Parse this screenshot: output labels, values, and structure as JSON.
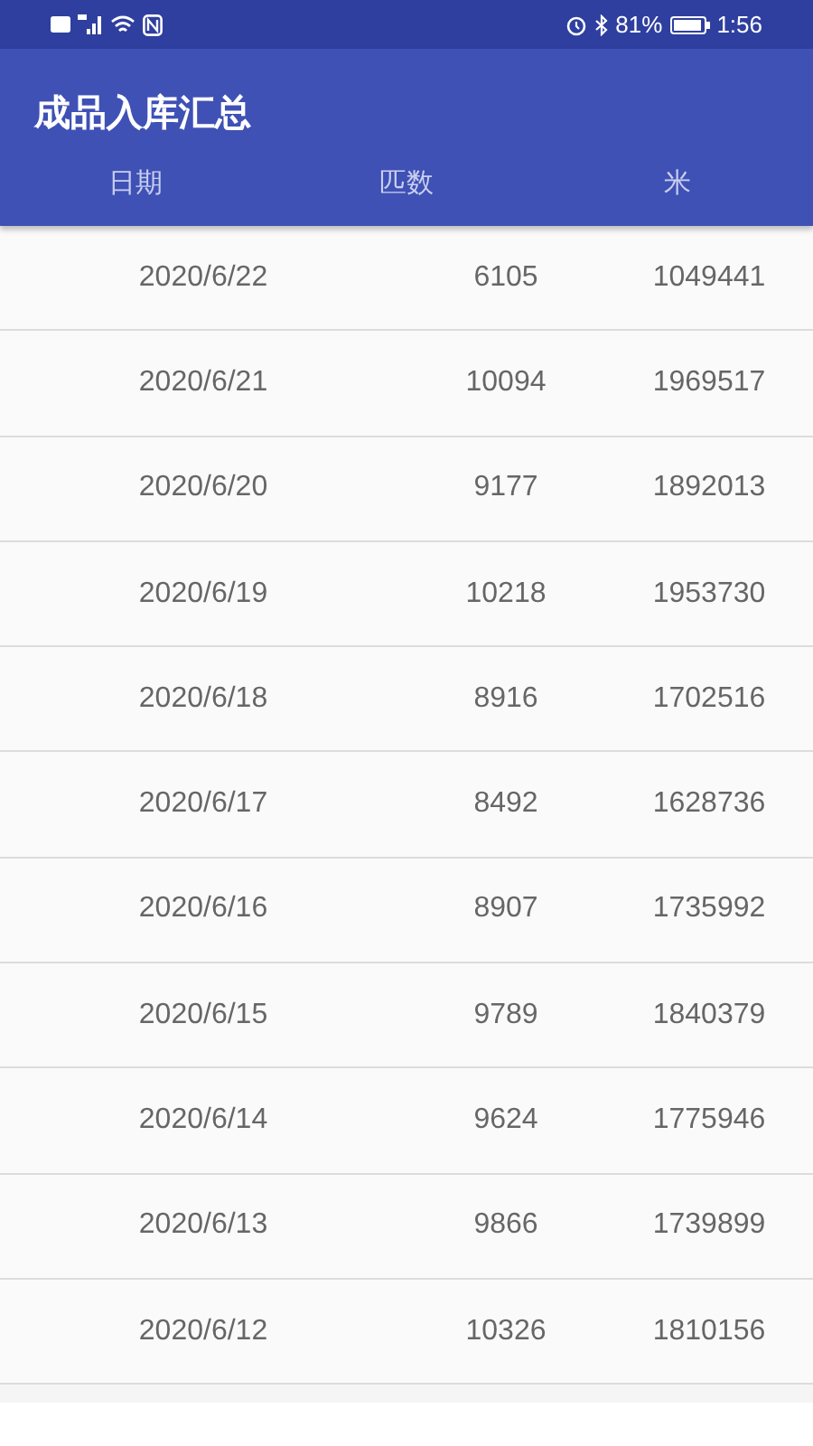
{
  "status_bar": {
    "battery_text": "81%",
    "time": "1:56"
  },
  "app_bar": {
    "title": "成品入库汇总"
  },
  "table": {
    "columns": [
      "日期",
      "匹数",
      "米"
    ],
    "rows": [
      [
        "2020/6/22",
        "6105",
        "1049441"
      ],
      [
        "2020/6/21",
        "10094",
        "1969517"
      ],
      [
        "2020/6/20",
        "9177",
        "1892013"
      ],
      [
        "2020/6/19",
        "10218",
        "1953730"
      ],
      [
        "2020/6/18",
        "8916",
        "1702516"
      ],
      [
        "2020/6/17",
        "8492",
        "1628736"
      ],
      [
        "2020/6/16",
        "8907",
        "1735992"
      ],
      [
        "2020/6/15",
        "9789",
        "1840379"
      ],
      [
        "2020/6/14",
        "9624",
        "1775946"
      ],
      [
        "2020/6/13",
        "9866",
        "1739899"
      ],
      [
        "2020/6/12",
        "10326",
        "1810156"
      ]
    ]
  }
}
